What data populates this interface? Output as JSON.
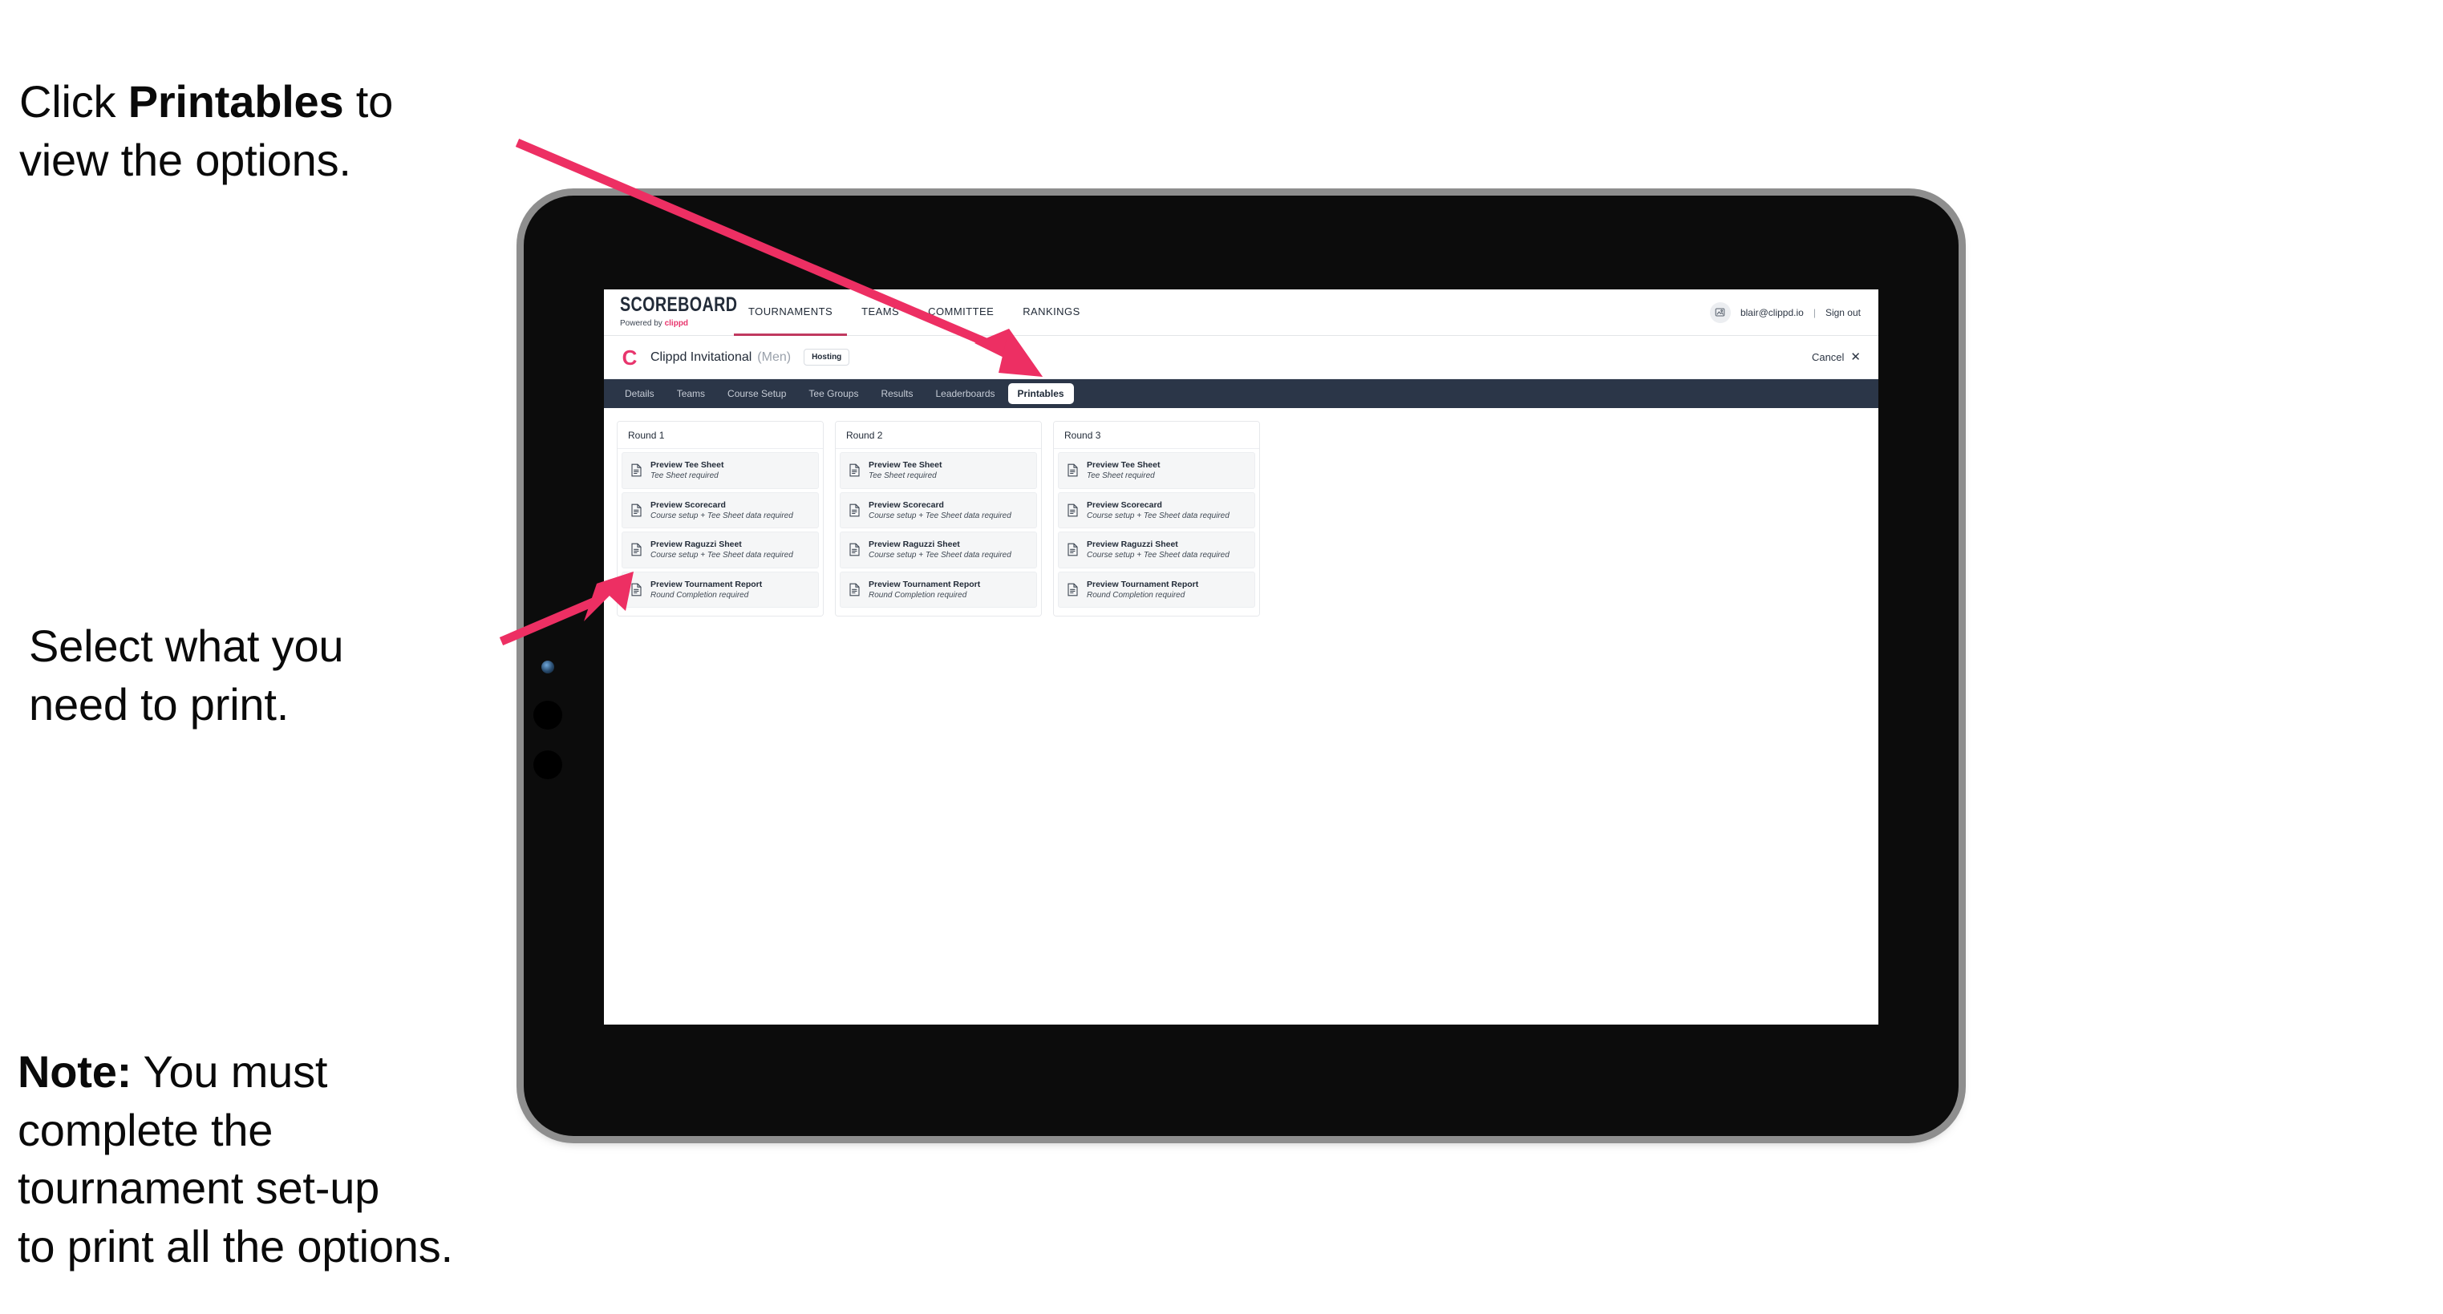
{
  "annotations": {
    "callout_1": "Click Printables to\nview the options.",
    "callout_1_prefix": "Click ",
    "callout_1_bold": "Printables",
    "callout_1_suffix": " to\nview the options.",
    "callout_2": "Select what you\n need to print.",
    "callout_3_bold": "Note:",
    "callout_3_rest": " You must\ncomplete the\ntournament set-up\nto print all the options."
  },
  "colors": {
    "accent_pink": "#e8356d",
    "arrow_pink": "#ed2f63",
    "tabstrip_navy": "#2b3648",
    "active_nav_underline": "#c0395f",
    "bezel_black": "#0c0c0c",
    "bezel_outer_gray": "#8e8e8e",
    "row_bg": "#f5f6f7"
  },
  "browser": {
    "brand": {
      "wordmark": "SCOREBOARD",
      "powered_by_prefix": "Powered by ",
      "powered_by_brand": "clippd"
    },
    "topnav": [
      {
        "label": "TOURNAMENTS",
        "active": true
      },
      {
        "label": "TEAMS",
        "active": false
      },
      {
        "label": "COMMITTEE",
        "active": false
      },
      {
        "label": "RANKINGS",
        "active": false
      }
    ],
    "user": {
      "avatar_icon": "user-avatar-icon",
      "email": "blair@clippd.io",
      "separator": "|",
      "sign_out_label": "Sign out"
    },
    "subheader": {
      "tournament_logo_letter": "C",
      "tournament_name": "Clippd Invitational",
      "gender": "(Men)",
      "hosting_chip": "Hosting",
      "cancel_label": "Cancel",
      "cancel_icon": "close-icon"
    },
    "tabs": [
      {
        "label": "Details",
        "active": false
      },
      {
        "label": "Teams",
        "active": false
      },
      {
        "label": "Course Setup",
        "active": false
      },
      {
        "label": "Tee Groups",
        "active": false
      },
      {
        "label": "Results",
        "active": false
      },
      {
        "label": "Leaderboards",
        "active": false
      },
      {
        "label": "Printables",
        "active": true
      }
    ],
    "rounds": [
      {
        "title": "Round 1",
        "items": [
          {
            "icon": "document-icon",
            "title": "Preview Tee Sheet",
            "subtitle": "Tee Sheet required"
          },
          {
            "icon": "document-icon",
            "title": "Preview Scorecard",
            "subtitle": "Course setup + Tee Sheet data required"
          },
          {
            "icon": "document-icon",
            "title": "Preview Raguzzi Sheet",
            "subtitle": "Course setup + Tee Sheet data required"
          },
          {
            "icon": "document-icon",
            "title": "Preview Tournament Report",
            "subtitle": "Round Completion required"
          }
        ]
      },
      {
        "title": "Round 2",
        "items": [
          {
            "icon": "document-icon",
            "title": "Preview Tee Sheet",
            "subtitle": "Tee Sheet required"
          },
          {
            "icon": "document-icon",
            "title": "Preview Scorecard",
            "subtitle": "Course setup + Tee Sheet data required"
          },
          {
            "icon": "document-icon",
            "title": "Preview Raguzzi Sheet",
            "subtitle": "Course setup + Tee Sheet data required"
          },
          {
            "icon": "document-icon",
            "title": "Preview Tournament Report",
            "subtitle": "Round Completion required"
          }
        ]
      },
      {
        "title": "Round 3",
        "items": [
          {
            "icon": "document-icon",
            "title": "Preview Tee Sheet",
            "subtitle": "Tee Sheet required"
          },
          {
            "icon": "document-icon",
            "title": "Preview Scorecard",
            "subtitle": "Course setup + Tee Sheet data required"
          },
          {
            "icon": "document-icon",
            "title": "Preview Raguzzi Sheet",
            "subtitle": "Course setup + Tee Sheet data required"
          },
          {
            "icon": "document-icon",
            "title": "Preview Tournament Report",
            "subtitle": "Round Completion required"
          }
        ]
      }
    ]
  }
}
